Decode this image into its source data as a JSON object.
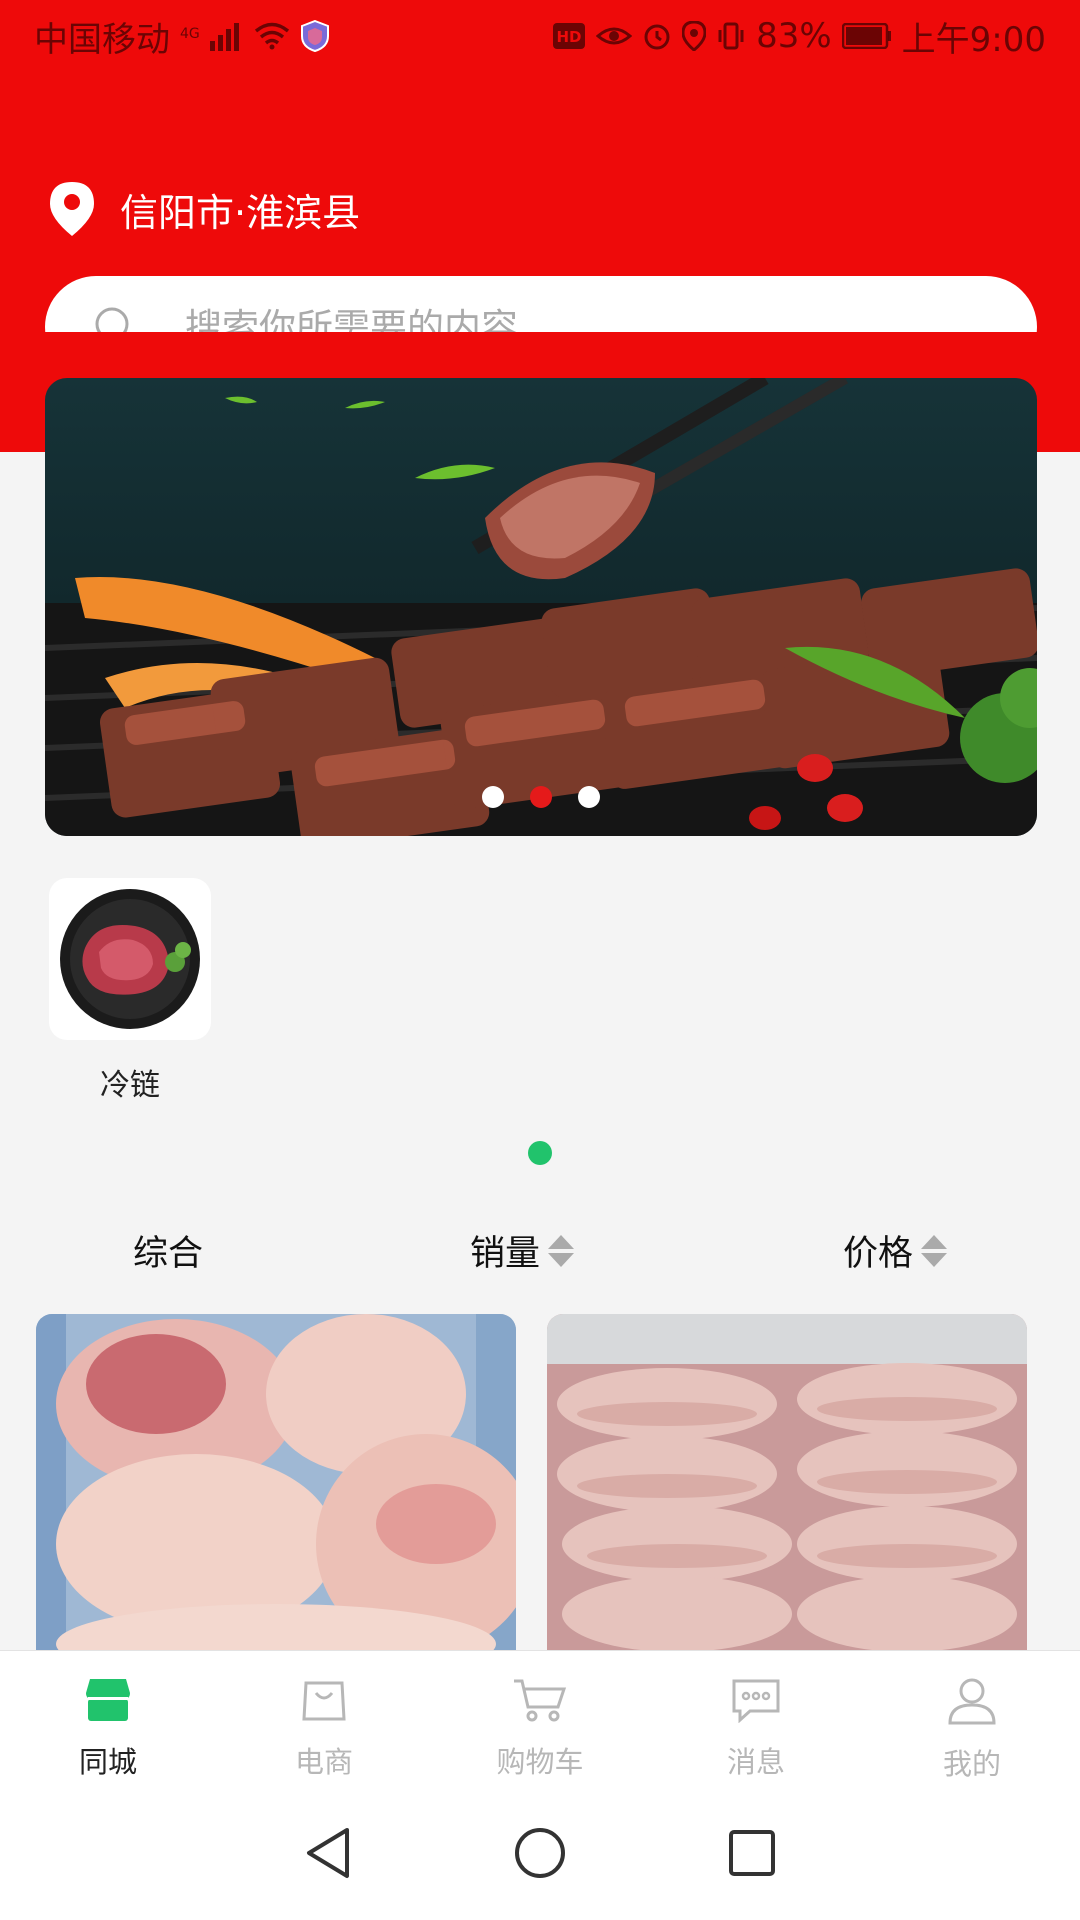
{
  "status_bar": {
    "carrier": "中国移动",
    "network": "4G",
    "battery": "83%",
    "time": "上午9:00"
  },
  "header": {
    "location": "信阳市·淮滨县",
    "search_placeholder": "搜索你所需要的内容"
  },
  "banner": {
    "slide_count": 3,
    "active_slide": 1
  },
  "categories": [
    {
      "label": "冷链",
      "icon": "meat-plate-image"
    }
  ],
  "sort_bar": {
    "items": [
      {
        "label": "综合",
        "sortable": false
      },
      {
        "label": "销量",
        "sortable": true
      },
      {
        "label": "价格",
        "sortable": true
      }
    ]
  },
  "products": [
    {
      "image": "pork-hocks-photo"
    },
    {
      "image": "pork-tongues-photo"
    }
  ],
  "tab_bar": {
    "tabs": [
      {
        "label": "同城",
        "icon": "store-icon",
        "active": true
      },
      {
        "label": "电商",
        "icon": "shopping-bag-icon",
        "active": false
      },
      {
        "label": "购物车",
        "icon": "cart-icon",
        "active": false
      },
      {
        "label": "消息",
        "icon": "message-icon",
        "active": false
      },
      {
        "label": "我的",
        "icon": "user-icon",
        "active": false
      }
    ]
  },
  "colors": {
    "brand_red": "#ee0a0a",
    "active_green": "#21c36c",
    "active_dot_red": "#e51a1a"
  }
}
